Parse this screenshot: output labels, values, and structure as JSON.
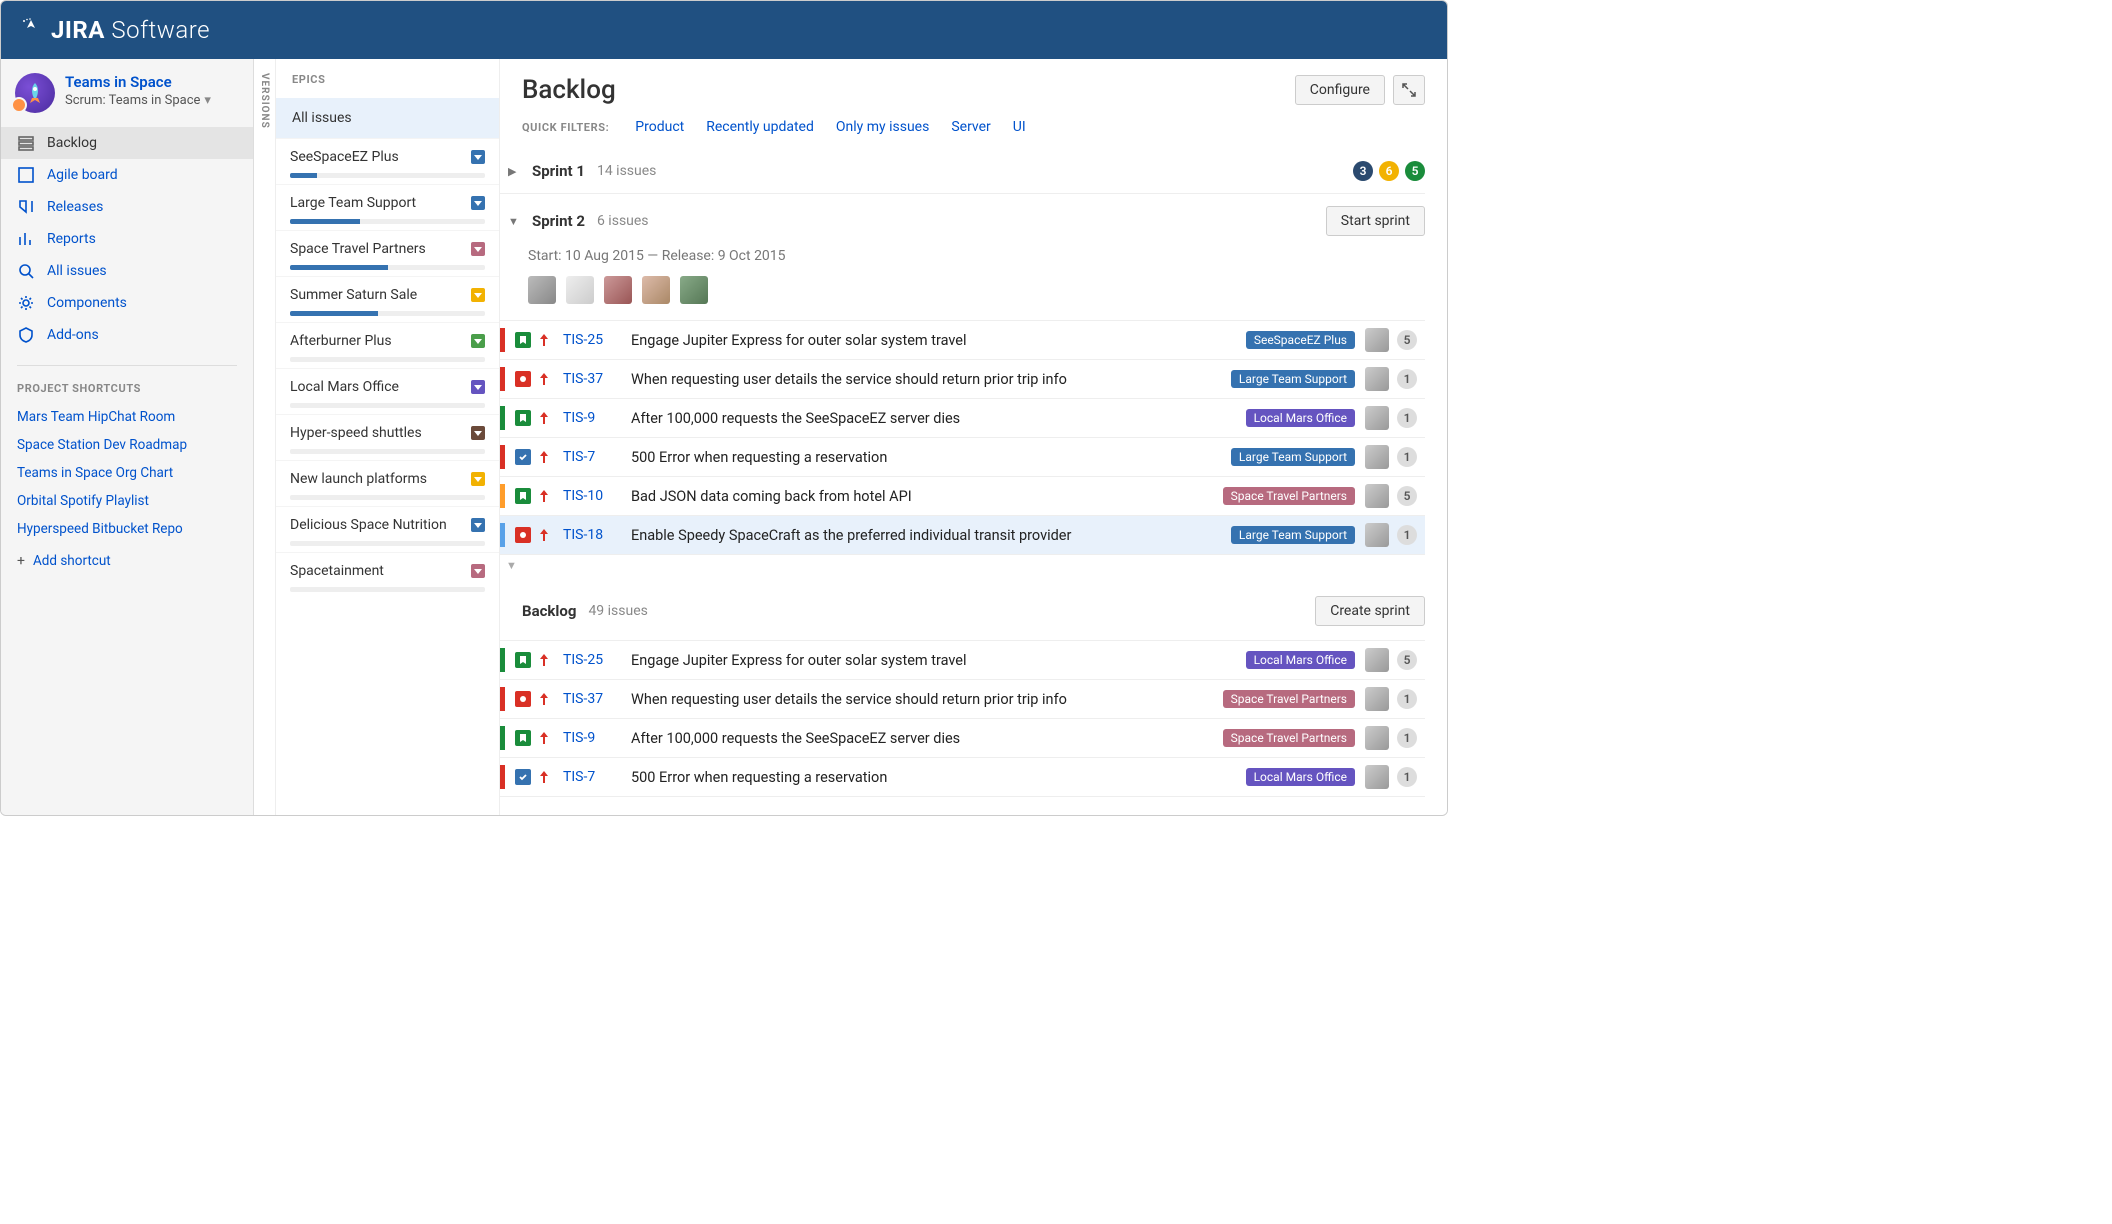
{
  "brand": {
    "bold": "JIRA",
    "soft": "Software"
  },
  "project": {
    "name": "Teams in Space",
    "subtitle": "Scrum: Teams in Space"
  },
  "nav": [
    {
      "label": "Backlog",
      "active": true
    },
    {
      "label": "Agile board"
    },
    {
      "label": "Releases"
    },
    {
      "label": "Reports"
    },
    {
      "label": "All issues"
    },
    {
      "label": "Components"
    },
    {
      "label": "Add-ons"
    }
  ],
  "shortcuts_label": "PROJECT SHORTCUTS",
  "shortcuts": [
    "Mars Team HipChat Room",
    "Space Station Dev Roadmap",
    "Teams in Space Org Chart",
    "Orbital Spotify Playlist",
    "Hyperspeed Bitbucket Repo"
  ],
  "add_shortcut": "Add shortcut",
  "versions_label": "VERSIONS",
  "epics_label": "EPICS",
  "all_issues_label": "All issues",
  "epics": [
    {
      "name": "SeeSpaceEZ Plus",
      "progress": 14,
      "drop": "#3572b0"
    },
    {
      "name": "Large Team Support",
      "progress": 36,
      "drop": "#3572b0"
    },
    {
      "name": "Space Travel Partners",
      "progress": 50,
      "drop": "#b76a7f"
    },
    {
      "name": "Summer Saturn Sale",
      "progress": 45,
      "drop": "#f2b202"
    },
    {
      "name": "Afterburner Plus",
      "progress": 0,
      "drop": "#4a9e4a"
    },
    {
      "name": "Local Mars Office",
      "progress": 0,
      "drop": "#6554c0"
    },
    {
      "name": "Hyper-speed shuttles",
      "progress": 0,
      "drop": "#6b4a3a"
    },
    {
      "name": "New launch platforms",
      "progress": 0,
      "drop": "#f2b202"
    },
    {
      "name": "Delicious Space Nutrition",
      "progress": 0,
      "drop": "#3572b0"
    },
    {
      "name": "Spacetainment",
      "progress": 0,
      "drop": "#b76a7f"
    }
  ],
  "page": {
    "title": "Backlog",
    "configure": "Configure"
  },
  "filters_label": "QUICK FILTERS:",
  "filters": [
    "Product",
    "Recently updated",
    "Only my issues",
    "Server",
    "UI"
  ],
  "sprint1": {
    "name": "Sprint 1",
    "count": "14 issues",
    "todo": "3",
    "prog": "6",
    "done": "5"
  },
  "sprint2": {
    "name": "Sprint 2",
    "count": "6 issues",
    "start_btn": "Start sprint",
    "dates": "Start: 10 Aug 2015   —   Release: 9 Oct 2015",
    "issues": [
      {
        "stripe": "red",
        "type": "story",
        "key": "TIS-25",
        "summary": "Engage Jupiter Express for outer solar system travel",
        "epic": "SeeSpaceEZ Plus",
        "epic_color": "blue",
        "est": "5"
      },
      {
        "stripe": "red",
        "type": "bug",
        "key": "TIS-37",
        "summary": "When requesting user details the service should return prior trip info",
        "epic": "Large Team Support",
        "epic_color": "blue",
        "est": "1"
      },
      {
        "stripe": "green",
        "type": "story",
        "key": "TIS-9",
        "summary": "After 100,000 requests the SeeSpaceEZ server dies",
        "epic": "Local Mars Office",
        "epic_color": "purple",
        "est": "1"
      },
      {
        "stripe": "red",
        "type": "task",
        "key": "TIS-7",
        "summary": "500 Error when requesting a reservation",
        "epic": "Large Team Support",
        "epic_color": "blue",
        "est": "1"
      },
      {
        "stripe": "orange",
        "type": "story",
        "key": "TIS-10",
        "summary": "Bad JSON data coming back from hotel API",
        "epic": "Space Travel Partners",
        "epic_color": "rose",
        "est": "5"
      },
      {
        "stripe": "blue",
        "type": "bug",
        "key": "TIS-18",
        "summary": "Enable Speedy SpaceCraft as the preferred individual transit provider",
        "epic": "Large Team Support",
        "epic_color": "blue",
        "est": "1",
        "selected": true
      }
    ]
  },
  "backlog": {
    "title": "Backlog",
    "count": "49 issues",
    "create_btn": "Create sprint",
    "issues": [
      {
        "stripe": "green",
        "type": "story",
        "key": "TIS-25",
        "summary": "Engage Jupiter Express for outer solar system travel",
        "epic": "Local Mars Office",
        "epic_color": "purple",
        "est": "5"
      },
      {
        "stripe": "red",
        "type": "bug",
        "key": "TIS-37",
        "summary": "When requesting user details the service should return prior trip info",
        "epic": "Space Travel Partners",
        "epic_color": "rose",
        "est": "1"
      },
      {
        "stripe": "green",
        "type": "story",
        "key": "TIS-9",
        "summary": "After 100,000 requests the SeeSpaceEZ server dies",
        "epic": "Space Travel Partners",
        "epic_color": "rose",
        "est": "1"
      },
      {
        "stripe": "red",
        "type": "task",
        "key": "TIS-7",
        "summary": "500 Error when requesting a reservation",
        "epic": "Local Mars Office",
        "epic_color": "purple",
        "est": "1"
      }
    ]
  }
}
